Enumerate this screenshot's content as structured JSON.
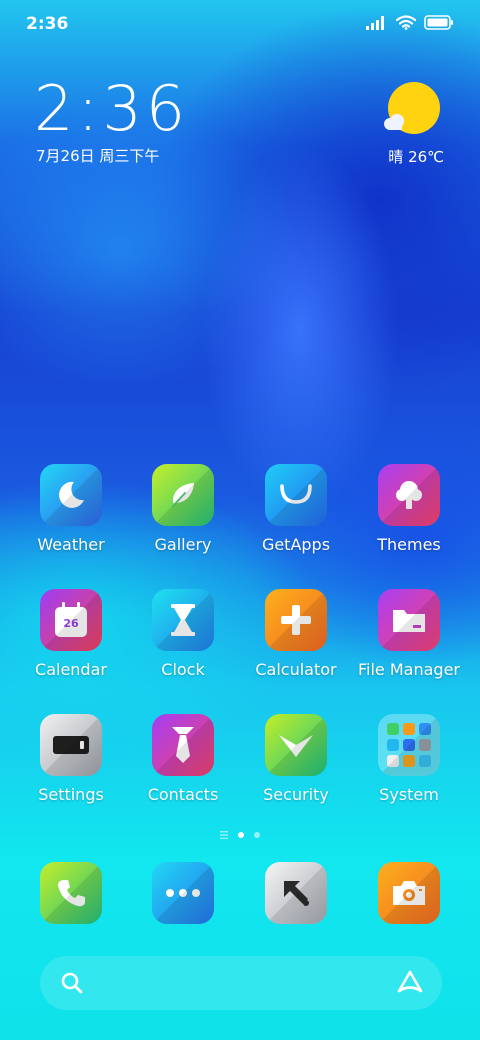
{
  "status_bar": {
    "time": "2:36"
  },
  "clock_widget": {
    "time": "2:36",
    "date": "7月26日 周三下午"
  },
  "weather_widget": {
    "condition": "晴",
    "temperature": "26℃"
  },
  "apps": [
    {
      "label": "Weather",
      "icon": "moon-icon"
    },
    {
      "label": "Gallery",
      "icon": "leaf-icon"
    },
    {
      "label": "GetApps",
      "icon": "bag-icon"
    },
    {
      "label": "Themes",
      "icon": "tree-icon"
    },
    {
      "label": "Calendar",
      "icon": "calendar-icon",
      "badge": "26"
    },
    {
      "label": "Clock",
      "icon": "hourglass-icon"
    },
    {
      "label": "Calculator",
      "icon": "plus-icon"
    },
    {
      "label": "File Manager",
      "icon": "folder-icon"
    },
    {
      "label": "Settings",
      "icon": "toggle-icon"
    },
    {
      "label": "Contacts",
      "icon": "tie-icon"
    },
    {
      "label": "Security",
      "icon": "check-shield-icon"
    },
    {
      "label": "System",
      "icon": "folder-grid-icon"
    }
  ],
  "dock": [
    {
      "name": "phone",
      "icon": "phone-icon"
    },
    {
      "name": "messages",
      "icon": "chat-dots-icon"
    },
    {
      "name": "browser",
      "icon": "arrow-icon"
    },
    {
      "name": "camera",
      "icon": "camera-icon"
    }
  ],
  "pager": {
    "pages": 2,
    "current": 1
  },
  "colors": {
    "weather": "#1fa4f2",
    "gallery": "#4ad55a",
    "getapps": "#1e9bf5",
    "themes": "#ea3a8f",
    "calendar": "#c83bd6",
    "clock": "#17a7e8",
    "calculator": "#f6891a",
    "filemanager": "#b63be0",
    "settings": "#a9aeb6",
    "contacts": "#b93ad8",
    "security": "#3acb67",
    "phone": "#49c65a",
    "messages": "#1f9af0",
    "browser": "#9ea4ad",
    "camera": "#f79018",
    "sun": "#ffd30f"
  }
}
